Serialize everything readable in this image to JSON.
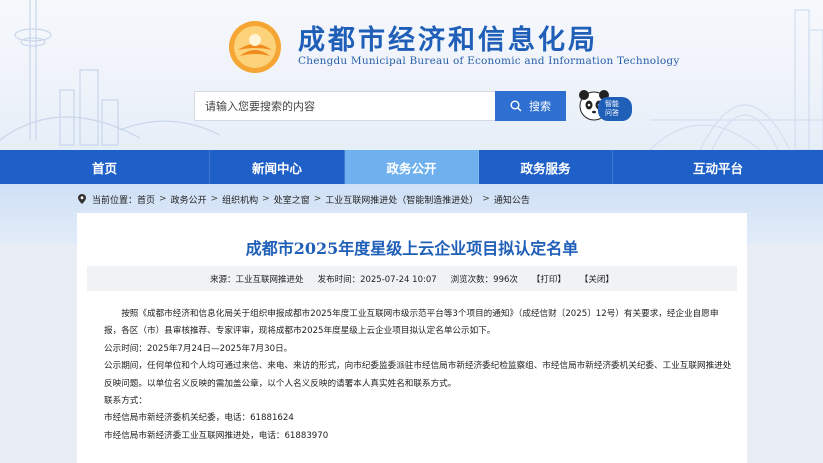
{
  "header": {
    "title": "成都市经济和信息化局",
    "subtitle": "Chengdu Municipal Bureau of Economic and Information Technology",
    "search_placeholder": "请输入您要搜索的内容",
    "search_button": "搜索",
    "assistant_label_1": "智能",
    "assistant_label_2": "问答",
    "brand_color": "#1f5fb8"
  },
  "nav": {
    "items": [
      {
        "label": "首页"
      },
      {
        "label": "新闻中心"
      },
      {
        "label": "政务公开"
      },
      {
        "label": "政务服务"
      },
      {
        "label": "互动平台"
      }
    ],
    "active_index": 2
  },
  "breadcrumb": {
    "prefix": "当前位置：",
    "items": [
      "首页",
      "政务公开",
      "组织机构",
      "处室之窗",
      "工业互联网推进处（智能制造推进处）",
      "通知公告"
    ],
    "separator": ">"
  },
  "article": {
    "title": "成都市2025年度星级上云企业项目拟认定名单",
    "source": "来源：工业互联网推进处",
    "published": "发布时间：2025-07-24 10:07",
    "views": "浏览次数：996次",
    "print_label": "【打印】",
    "close_label": "【关闭】",
    "paragraphs": [
      "按照《成都市经济和信息化局关于组织申报成都市2025年度工业互联网市级示范平台等3个项目的通知》（成经信财〔2025〕12号）有关要求，经企业自愿申报，各区（市）县审核推荐、专家评审，现将成都市2025年度星级上云企业项目拟认定名单公示如下。",
      "公示时间：2025年7月24日—2025年7月30日。",
      "公示期间，任何单位和个人均可通过来信、来电、来访的形式，向市纪委监委派驻市经信局市新经济委纪检监察组、市经信局市新经济委机关纪委、工业互联网推进处反映问题。以单位名义反映的需加盖公章，以个人名义反映的请署本人真实姓名和联系方式。",
      "联系方式：",
      "市经信局市新经济委机关纪委，电话：61881624",
      "市经信局市新经济委工业互联网推进处，电话：61883970"
    ]
  }
}
